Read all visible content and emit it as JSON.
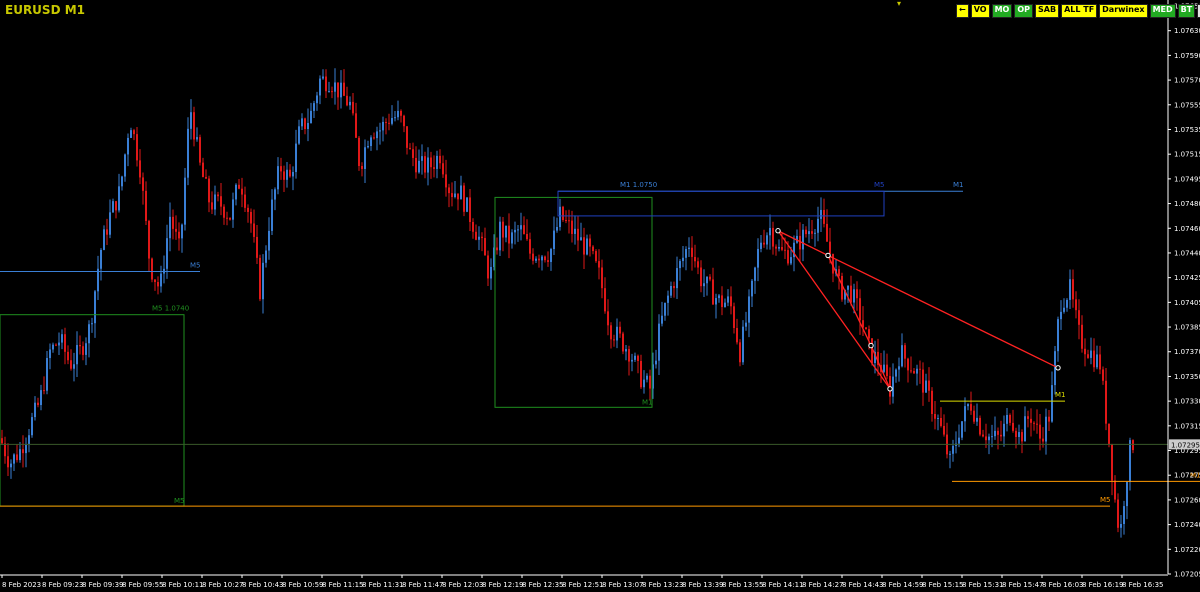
{
  "chart_title": "EURUSD M1",
  "toolbar": [
    {
      "label": "←",
      "bg": "#ffff00",
      "fg": "#000000"
    },
    {
      "label": "VO",
      "bg": "#ffff00",
      "fg": "#000000"
    },
    {
      "label": "MO",
      "bg": "#22aa22",
      "fg": "#ffffff"
    },
    {
      "label": "OP",
      "bg": "#22aa22",
      "fg": "#ffffff"
    },
    {
      "label": "SAB",
      "bg": "#ffff00",
      "fg": "#000000"
    },
    {
      "label": "ALL TF",
      "bg": "#ffff00",
      "fg": "#000000"
    },
    {
      "label": "Darwinex",
      "bg": "#ffff00",
      "fg": "#000000"
    },
    {
      "label": "MED",
      "bg": "#22aa22",
      "fg": "#ffffff"
    },
    {
      "label": "BT",
      "bg": "#22aa22",
      "fg": "#ffffff"
    },
    {
      "label": "SIM",
      "bg": "#e0e0e0",
      "fg": "#000000"
    }
  ],
  "chart_data": {
    "type": "candlestick",
    "symbol": "EURUSD",
    "timeframe": "M1",
    "ylim": [
      1.0719,
      1.0765
    ],
    "y_ticks": [
      "1.07650",
      "1.07630",
      "1.07590",
      "1.07570",
      "1.07555",
      "1.07535",
      "1.07515",
      "1.07495",
      "1.07480",
      "1.07460",
      "1.07440",
      "1.07425",
      "1.07405",
      "1.07385",
      "1.07370",
      "1.07350",
      "1.07330",
      "1.07315",
      "1.07295",
      "1.07275",
      "1.07260",
      "1.07240",
      "1.07220",
      "1.07205"
    ],
    "x_ticks": [
      "8 Feb 2023",
      "8 Feb 09:23",
      "8 Feb 09:39",
      "8 Feb 09:55",
      "8 Feb 10:11",
      "8 Feb 10:27",
      "8 Feb 10:43",
      "8 Feb 10:59",
      "8 Feb 11:15",
      "8 Feb 11:31",
      "8 Feb 11:47",
      "8 Feb 12:03",
      "8 Feb 12:19",
      "8 Feb 12:35",
      "8 Feb 12:51",
      "8 Feb 13:07",
      "8 Feb 13:23",
      "8 Feb 13:39",
      "8 Feb 13:55",
      "8 Feb 14:11",
      "8 Feb 14:27",
      "8 Feb 14:43",
      "8 Feb 14:59",
      "8 Feb 15:15",
      "8 Feb 15:31",
      "8 Feb 15:47",
      "8 Feb 16:03",
      "8 Feb 16:19",
      "8 Feb 16:35"
    ],
    "bull_color": "#3a7fd5",
    "bear_color": "#e01818",
    "bid_price": "1.07295",
    "bid_value": 1.07295,
    "close_path": [
      [
        0,
        1.073
      ],
      [
        10,
        1.0728
      ],
      [
        20,
        1.0729
      ],
      [
        30,
        1.0731
      ],
      [
        40,
        1.0733
      ],
      [
        50,
        1.0737
      ],
      [
        60,
        1.0738
      ],
      [
        70,
        1.0736
      ],
      [
        80,
        1.0737
      ],
      [
        90,
        1.0739
      ],
      [
        100,
        1.0745
      ],
      [
        110,
        1.0748
      ],
      [
        120,
        1.075
      ],
      [
        130,
        1.0756
      ],
      [
        140,
        1.0752
      ],
      [
        150,
        1.0744
      ],
      [
        160,
        1.0742
      ],
      [
        170,
        1.0748
      ],
      [
        180,
        1.0745
      ],
      [
        190,
        1.0757
      ],
      [
        200,
        1.0752
      ],
      [
        210,
        1.0749
      ],
      [
        220,
        1.0749
      ],
      [
        230,
        1.0748
      ],
      [
        240,
        1.0751
      ],
      [
        250,
        1.0748
      ],
      [
        260,
        1.0742
      ],
      [
        270,
        1.0748
      ],
      [
        280,
        1.0752
      ],
      [
        290,
        1.0751
      ],
      [
        300,
        1.0755
      ],
      [
        310,
        1.0756
      ],
      [
        320,
        1.0759
      ],
      [
        330,
        1.0759
      ],
      [
        340,
        1.0758
      ],
      [
        350,
        1.0757
      ],
      [
        360,
        1.0752
      ],
      [
        370,
        1.0755
      ],
      [
        380,
        1.0755
      ],
      [
        390,
        1.0756
      ],
      [
        400,
        1.0756
      ],
      [
        410,
        1.0753
      ],
      [
        420,
        1.0752
      ],
      [
        430,
        1.0752
      ],
      [
        440,
        1.0753
      ],
      [
        450,
        1.075
      ],
      [
        460,
        1.075
      ],
      [
        470,
        1.0748
      ],
      [
        480,
        1.0746
      ],
      [
        490,
        1.0743
      ],
      [
        500,
        1.0747
      ],
      [
        510,
        1.0746
      ],
      [
        520,
        1.0747
      ],
      [
        530,
        1.0745
      ],
      [
        540,
        1.0745
      ],
      [
        550,
        1.0745
      ],
      [
        560,
        1.0748
      ],
      [
        570,
        1.0747
      ],
      [
        580,
        1.0746
      ],
      [
        590,
        1.0745
      ],
      [
        600,
        1.0743
      ],
      [
        610,
        1.0739
      ],
      [
        620,
        1.0738
      ],
      [
        630,
        1.0737
      ],
      [
        640,
        1.0735
      ],
      [
        650,
        1.0734
      ],
      [
        660,
        1.0739
      ],
      [
        670,
        1.0742
      ],
      [
        680,
        1.0744
      ],
      [
        690,
        1.0746
      ],
      [
        700,
        1.0743
      ],
      [
        710,
        1.0742
      ],
      [
        720,
        1.0741
      ],
      [
        730,
        1.0741
      ],
      [
        740,
        1.0737
      ],
      [
        750,
        1.0741
      ],
      [
        760,
        1.0746
      ],
      [
        770,
        1.0747
      ],
      [
        780,
        1.0745
      ],
      [
        790,
        1.0745
      ],
      [
        800,
        1.0746
      ],
      [
        810,
        1.0747
      ],
      [
        820,
        1.0748
      ],
      [
        830,
        1.0745
      ],
      [
        840,
        1.0742
      ],
      [
        850,
        1.0742
      ],
      [
        860,
        1.074
      ],
      [
        870,
        1.0737
      ],
      [
        880,
        1.0736
      ],
      [
        890,
        1.0734
      ],
      [
        900,
        1.0737
      ],
      [
        910,
        1.0736
      ],
      [
        920,
        1.0735
      ],
      [
        930,
        1.0733
      ],
      [
        940,
        1.0731
      ],
      [
        950,
        1.0728
      ],
      [
        960,
        1.0731
      ],
      [
        970,
        1.0733
      ],
      [
        980,
        1.0731
      ],
      [
        990,
        1.073
      ],
      [
        1000,
        1.073
      ],
      [
        1010,
        1.0732
      ],
      [
        1020,
        1.073
      ],
      [
        1030,
        1.0732
      ],
      [
        1040,
        1.073
      ],
      [
        1050,
        1.0732
      ],
      [
        1060,
        1.0741
      ],
      [
        1070,
        1.0742
      ],
      [
        1080,
        1.0738
      ],
      [
        1090,
        1.0737
      ],
      [
        1100,
        1.0736
      ],
      [
        1110,
        1.0729
      ],
      [
        1115,
        1.0725
      ],
      [
        1120,
        1.0722
      ],
      [
        1125,
        1.0726
      ],
      [
        1130,
        1.0729
      ],
      [
        1135,
        1.073
      ]
    ],
    "zones": [
      {
        "kind": "line",
        "price": 1.07435,
        "x1": 0,
        "x2": 200,
        "color": "#3a7fd5",
        "label": "M5",
        "label_at": "end"
      },
      {
        "kind": "box",
        "p_top": 1.074,
        "p_bot": 1.07245,
        "x1": 0,
        "x2": 184,
        "color": "#1f8f1f",
        "label": "M5 1.0740",
        "label2": "M5"
      },
      {
        "kind": "line",
        "price": 1.07245,
        "x1": 0,
        "x2": 1110,
        "color": "#ff9900",
        "label": "M5",
        "label_at": "end"
      },
      {
        "kind": "box",
        "p_top": 1.07495,
        "p_bot": 1.07325,
        "x1": 495,
        "x2": 652,
        "color": "#1f8f1f",
        "label": "",
        "label2": "M1"
      },
      {
        "kind": "line",
        "price": 1.075,
        "x1": 558,
        "x2": 963,
        "color": "#3a7fd5",
        "label": "M1 1.0750",
        "label_at": "start",
        "label2": "M1"
      },
      {
        "kind": "box",
        "p_top": 1.075,
        "p_bot": 1.0748,
        "x1": 558,
        "x2": 884,
        "color": "#2040c0",
        "label": "M5",
        "label_at": "end"
      },
      {
        "kind": "line",
        "price": 1.0733,
        "x1": 940,
        "x2": 1065,
        "color": "#dddd00",
        "label": "M1",
        "label_at": "end"
      },
      {
        "kind": "line",
        "price": 1.07265,
        "x1": 952,
        "x2": 1200,
        "color": "#ff9900",
        "label": "M1",
        "label_at": "end"
      },
      {
        "kind": "line",
        "price": 1.07295,
        "x1": 0,
        "x2": 1168,
        "color": "#3a5a2a",
        "label": "",
        "label_at": "end"
      }
    ],
    "pattern": {
      "color": "#ff2222",
      "points": [
        [
          778,
          1.07468
        ],
        [
          828,
          1.07448
        ],
        [
          871,
          1.07375
        ],
        [
          890,
          1.0734
        ],
        [
          1058,
          1.07357
        ]
      ],
      "edges": [
        [
          0,
          1
        ],
        [
          1,
          2
        ],
        [
          2,
          3
        ],
        [
          0,
          3
        ],
        [
          1,
          4
        ]
      ]
    }
  }
}
